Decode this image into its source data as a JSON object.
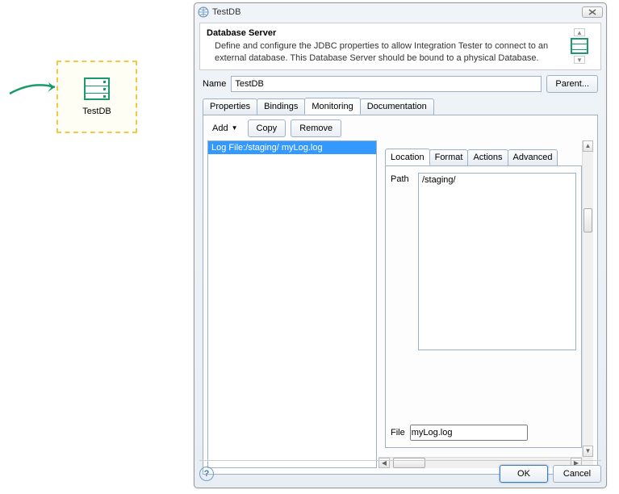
{
  "left_node": {
    "label": "TestDB"
  },
  "dialog": {
    "title": "TestDB",
    "header": {
      "title": "Database Server",
      "description": "Define and configure the JDBC properties to allow                 Integration Tester to connect to an external database. This Database Server should be bound to a physical Database."
    },
    "name_label": "Name",
    "name_value": "TestDB",
    "parent_button": "Parent...",
    "tabs": [
      {
        "label": "Properties"
      },
      {
        "label": "Bindings"
      },
      {
        "label": "Monitoring"
      },
      {
        "label": "Documentation"
      }
    ],
    "active_tab": 2,
    "monitoring": {
      "add_label": "Add",
      "copy_label": "Copy",
      "remove_label": "Remove",
      "list_items": [
        "Log File:/staging/ myLog.log"
      ],
      "sub_tabs": [
        {
          "label": "Location"
        },
        {
          "label": "Format"
        },
        {
          "label": "Actions"
        },
        {
          "label": "Advanced"
        }
      ],
      "active_sub_tab": 0,
      "path_label": "Path",
      "path_value": "/staging/",
      "file_label": "File",
      "file_value": "myLog.log"
    },
    "footer": {
      "ok": "OK",
      "cancel": "Cancel"
    }
  }
}
